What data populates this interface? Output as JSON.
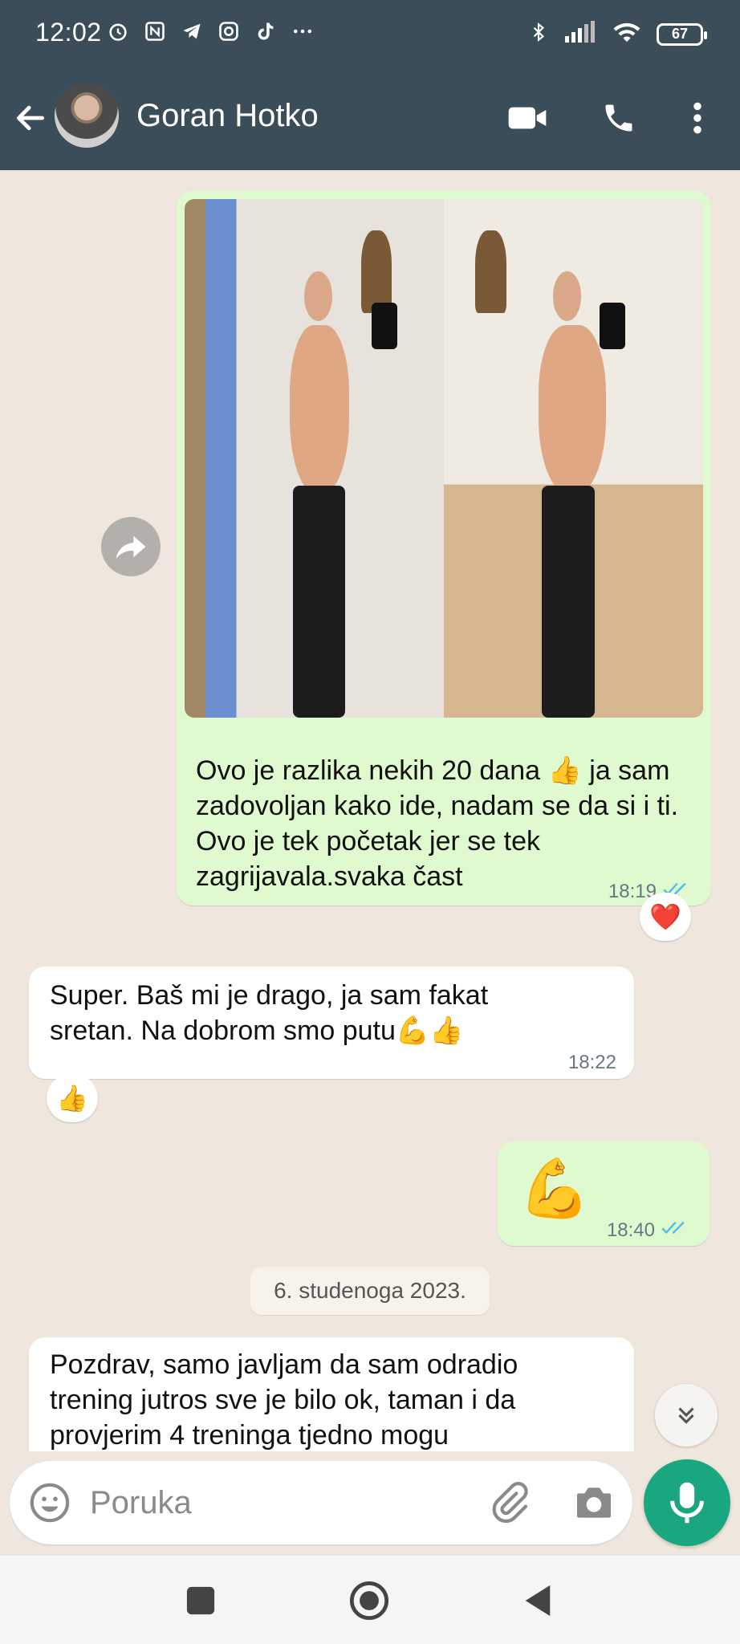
{
  "status_bar": {
    "time": "12:02",
    "battery": "67"
  },
  "header": {
    "contact_name": "Goran Hotko"
  },
  "messages": [
    {
      "direction": "out",
      "text": "Ovo je razlika nekih 20 dana 👍 ja sam zadovoljan kako ide, nadam se da si i ti. Ovo je tek početak jer se tek zagrijavala.svaka čast",
      "time": "18:19",
      "reaction": "❤️"
    },
    {
      "direction": "in",
      "text": "Super. Baš mi je drago, ja sam fakat sretan. Na dobrom smo putu💪👍",
      "time": "18:22",
      "reaction": "👍"
    },
    {
      "direction": "out",
      "text": "💪",
      "time": "18:40"
    },
    {
      "direction": "in",
      "text": "Pozdrav, samo javljam da sam odradio trening jutros sve je bilo ok, taman i da provjerim 4 treninga tjedno mogu"
    }
  ],
  "date_separator": "6. studenoga 2023.",
  "composer": {
    "placeholder": "Poruka"
  },
  "colors": {
    "header": "#3b4d59",
    "outgoing_bubble": "#e0fad0",
    "incoming_bubble": "#ffffff",
    "mic_button": "#1aa67f",
    "read_ticks": "#53bdeb"
  }
}
